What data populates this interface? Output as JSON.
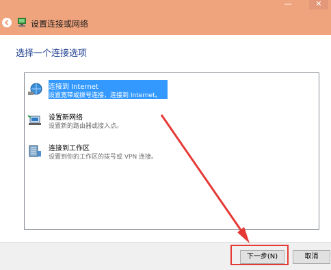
{
  "window": {
    "title": "设置连接或网络",
    "minimize_glyph": "—",
    "close_glyph": "✕"
  },
  "heading": "选择一个连接选项",
  "options": [
    {
      "title": "连接到 Internet",
      "description": "设置宽带或拨号连接，连接到 Internet。",
      "icon": "globe-icon",
      "selected": true
    },
    {
      "title": "设置新网络",
      "description": "设置新的路由器或接入点。",
      "icon": "router-icon",
      "selected": false
    },
    {
      "title": "连接到工作区",
      "description": "设置到你的工作区的拨号或 VPN 连接。",
      "icon": "workplace-icon",
      "selected": false
    }
  ],
  "buttons": {
    "next": "下一步(N)",
    "cancel": "取消"
  },
  "annotation": {
    "color": "#e53935",
    "highlighted_button": "next"
  },
  "colors": {
    "titlebar": "#f0a47d",
    "heading": "#1e3f8f",
    "selection": "#3399ff"
  }
}
